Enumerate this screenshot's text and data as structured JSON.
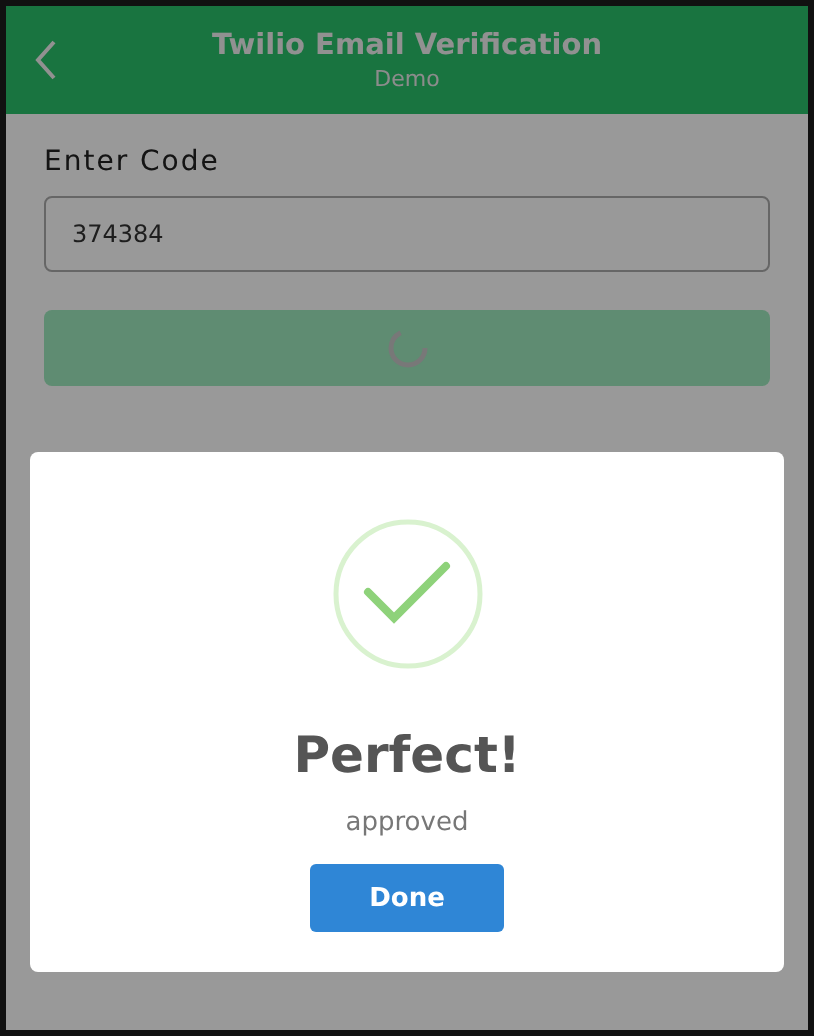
{
  "header": {
    "title": "Twilio Email Verification",
    "subtitle": "Demo"
  },
  "form": {
    "label": "Enter Code",
    "code_field": {
      "value": "374384"
    },
    "submit": {
      "loading": true
    }
  },
  "dialog": {
    "open": true,
    "kind": "success",
    "title": "Perfect!",
    "message": "approved",
    "button": "Done"
  }
}
